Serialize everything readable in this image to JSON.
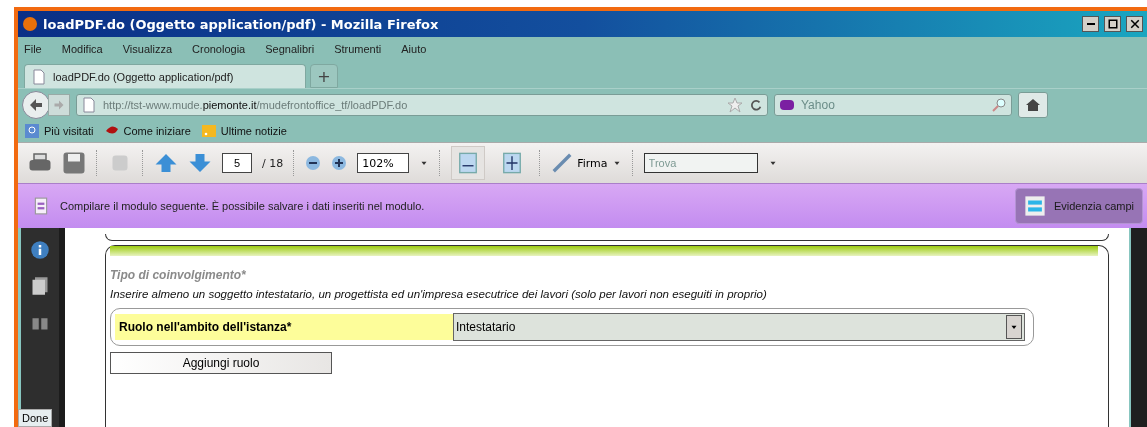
{
  "window": {
    "title": "loadPDF.do (Oggetto application/pdf) - Mozilla Firefox"
  },
  "menu": [
    "File",
    "Modifica",
    "Visualizza",
    "Cronologia",
    "Segnalibri",
    "Strumenti",
    "Aiuto"
  ],
  "tabs": [
    {
      "label": "loadPDF.do (Oggetto application/pdf)",
      "selected": true
    }
  ],
  "new_tab": "+",
  "address": {
    "prefix": "http://tst-www.mude.",
    "domain": "piemonte.it",
    "path": "/mudefrontoffice_tf/loadPDF.do"
  },
  "search": {
    "placeholder": "Yahoo"
  },
  "bookmarks": [
    {
      "label": "Più visitati",
      "kind": "search"
    },
    {
      "label": "Come iniziare",
      "kind": "start"
    },
    {
      "label": "Ultime notizie",
      "kind": "feed"
    }
  ],
  "pdf_toolbar": {
    "page": "5",
    "total": "/ 18",
    "zoom": "102%",
    "sign": "Firma",
    "find": {
      "placeholder": "Trova"
    }
  },
  "notification": {
    "text": "Compilare il modulo seguente. È possibile salvare i dati inseriti nel modulo.",
    "button": "Evidenzia campi"
  },
  "form": {
    "section_title": "Tipo di coinvolgimento*",
    "instruction": "Inserire almeno un soggetto intestatario, un progettista ed un'impresa esecutrice dei lavori (solo per lavori non eseguiti in proprio)",
    "field_label": "Ruolo nell'ambito dell'istanza*",
    "field_value": "Intestatario",
    "add_button": "Aggiungi ruolo"
  },
  "status_bar": {
    "text": "Done"
  }
}
